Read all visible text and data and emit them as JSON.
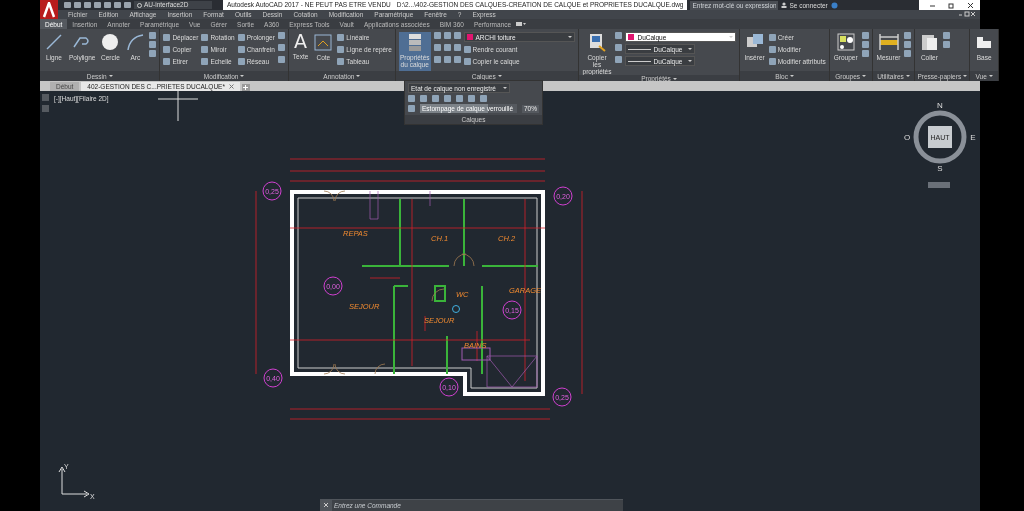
{
  "title_bar": {
    "workspace": "AU-interface2D",
    "title": "Autodesk AutoCAD 2017 - NE PEUT PAS ETRE VENDU",
    "file_path": "D:\\2...\\402-GESTION DES CALQUES-CREATION DE CALQUE et PROPRIETES DUCALQUE.dwg",
    "search": {
      "placeholder": "Entrez mot-clé ou expression"
    },
    "sign_in": "Se connecter"
  },
  "menu_bar": [
    "Fichier",
    "Edition",
    "Affichage",
    "Insertion",
    "Format",
    "Outils",
    "Dessin",
    "Cotation",
    "Modification",
    "Paramétrique",
    "Fenêtre",
    "?",
    "Express"
  ],
  "ribbon_tabs": [
    {
      "label": "Début",
      "selected": true
    },
    {
      "label": "Insertion",
      "selected": false
    },
    {
      "label": "Annoter",
      "selected": false
    },
    {
      "label": "Paramétrique",
      "selected": false
    },
    {
      "label": "Vue",
      "selected": false
    },
    {
      "label": "Gérer",
      "selected": false
    },
    {
      "label": "Sortie",
      "selected": false
    },
    {
      "label": "A360",
      "selected": false
    },
    {
      "label": "Express Tools",
      "selected": false
    },
    {
      "label": "Vault",
      "selected": false
    },
    {
      "label": "Applications associées",
      "selected": false
    },
    {
      "label": "BIM 360",
      "selected": false
    },
    {
      "label": "Performance",
      "selected": false
    }
  ],
  "ribbon_panels": [
    {
      "title": "Dessin",
      "large": [
        {
          "label": "Ligne"
        },
        {
          "label": "Polyligne"
        },
        {
          "label": "Cercle"
        },
        {
          "label": "Arc"
        }
      ],
      "rows": [
        [
          {
            "kind": "icon"
          }
        ],
        [
          {
            "kind": "icon"
          }
        ],
        [
          {
            "kind": "icon"
          }
        ]
      ]
    },
    {
      "title": "Modification",
      "rows": [
        [
          {
            "kind": "small",
            "label": "Déplacer"
          },
          {
            "kind": "small",
            "label": "Rotation"
          },
          {
            "kind": "small",
            "label": "Prolonger"
          },
          {
            "kind": "icon"
          }
        ],
        [
          {
            "kind": "small",
            "label": "Copier"
          },
          {
            "kind": "small",
            "label": "Miroir"
          },
          {
            "kind": "small",
            "label": "Chanfrein"
          },
          {
            "kind": "icon"
          }
        ],
        [
          {
            "kind": "small",
            "label": "Etirer"
          },
          {
            "kind": "small",
            "label": "Echelle"
          },
          {
            "kind": "small",
            "label": "Réseau"
          },
          {
            "kind": "icon"
          }
        ]
      ]
    },
    {
      "title": "Annotation",
      "large": [
        {
          "label": "Texte",
          "glyph": "A"
        },
        {
          "label": "Cote"
        }
      ],
      "rows": [
        [
          {
            "kind": "small",
            "label": "Linéaire"
          }
        ],
        [
          {
            "kind": "small",
            "label": "Ligne de repère"
          }
        ],
        [
          {
            "kind": "small",
            "label": "Tableau"
          }
        ]
      ]
    },
    {
      "title": "Calques",
      "large": [
        {
          "label": "Propriétés du calque"
        }
      ],
      "rows": [
        [
          {
            "kind": "icon"
          },
          {
            "kind": "icon"
          },
          {
            "kind": "icon"
          },
          {
            "kind": "select",
            "value": "ARCHI toiture",
            "color": "#e0156f"
          }
        ],
        [
          {
            "kind": "icon"
          },
          {
            "kind": "icon"
          },
          {
            "kind": "icon"
          },
          {
            "kind": "small",
            "label": "Rendre courant"
          }
        ],
        [
          {
            "kind": "icon"
          },
          {
            "kind": "icon"
          },
          {
            "kind": "icon"
          },
          {
            "kind": "small",
            "label": "Copier le calque"
          }
        ]
      ]
    },
    {
      "title": "Propriétés",
      "large": [
        {
          "label": "Copier les propriétés"
        }
      ],
      "rows": [
        [
          {
            "kind": "icon"
          },
          {
            "kind": "select",
            "value": "DuCalque",
            "color": "#e0156f"
          }
        ],
        [
          {
            "kind": "icon"
          },
          {
            "kind": "line-select",
            "value": "DuCalque"
          }
        ],
        [
          {
            "kind": "icon"
          },
          {
            "kind": "line-select",
            "value": "DuCalque"
          }
        ]
      ]
    },
    {
      "title": "Bloc",
      "large": [
        {
          "label": "Insérer"
        }
      ],
      "rows": [
        [
          {
            "kind": "small",
            "label": "Créer"
          }
        ],
        [
          {
            "kind": "small",
            "label": "Modifier"
          }
        ],
        [
          {
            "kind": "small",
            "label": "Modifier attributs"
          }
        ]
      ]
    },
    {
      "title": "Groupes",
      "large": [
        {
          "label": "Grouper"
        }
      ],
      "rows": [
        [
          {
            "kind": "icon"
          }
        ],
        [
          {
            "kind": "icon"
          }
        ],
        [
          {
            "kind": "icon"
          }
        ]
      ]
    },
    {
      "title": "Utilitaires",
      "large": [
        {
          "label": "Mesurer"
        }
      ],
      "rows": [
        [
          {
            "kind": "icon"
          }
        ],
        [
          {
            "kind": "icon"
          }
        ],
        [
          {
            "kind": "icon"
          }
        ]
      ]
    },
    {
      "title": "Presse-papiers",
      "large": [
        {
          "label": "Coller"
        }
      ],
      "rows": [
        [
          {
            "kind": "icon"
          }
        ],
        [
          {
            "kind": "icon"
          }
        ]
      ]
    },
    {
      "title": "Vue",
      "large": [
        {
          "label": "Base"
        }
      ]
    }
  ],
  "layer_flyout": {
    "state": "Etat de calque non enregistré",
    "fade_label": "Estompage de calque verrouillé",
    "fade_value": "70%",
    "level": 0.7,
    "title": "Calques"
  },
  "file_tabs": [
    {
      "label": "Début",
      "selected": false
    },
    {
      "label": "402-GESTION DES C...PRIETES DUCALQUE*",
      "selected": true
    }
  ],
  "viewport": {
    "label": "[-][Haut][Filaire 2D]",
    "view_cube": {
      "north": "N",
      "south": "S",
      "east": "E",
      "west": "O",
      "face": "HAUT"
    },
    "ucs": {
      "x": "X",
      "y": "Y"
    },
    "rooms": [
      "REPAS",
      "CH.1",
      "CH.2",
      "SEJOUR",
      "SEJOUR",
      "WC",
      "GARAGE",
      "BAINS"
    ],
    "levels": [
      "0,25",
      "0,20",
      "0,00",
      "0,15",
      "0,40",
      "0,10",
      "0,25"
    ]
  },
  "command_line": {
    "placeholder": "Entrez une Commande"
  }
}
